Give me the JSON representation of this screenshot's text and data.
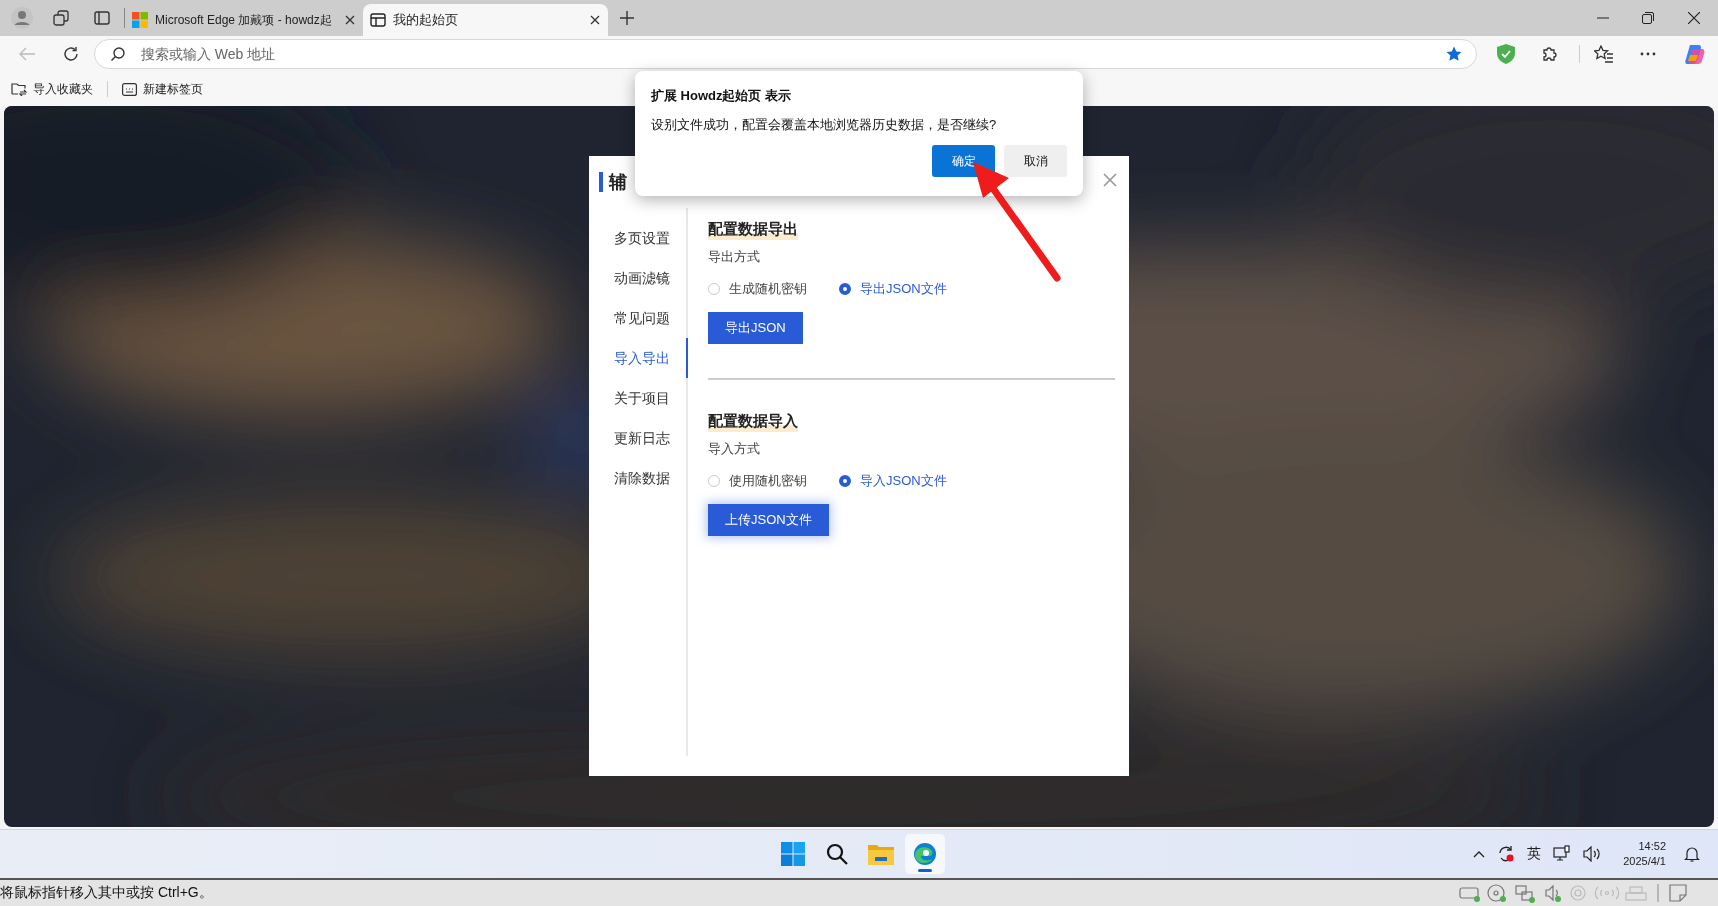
{
  "browser": {
    "tabs": [
      {
        "title": "Microsoft Edge 加戴项 - howdz起",
        "kind": "store",
        "selected": false
      },
      {
        "title": "我的起始页",
        "kind": "page",
        "selected": true
      }
    ],
    "address_placeholder": "搜索或输入 Web 地址",
    "favorite_starred": true,
    "favorites_bar": [
      {
        "label": "导入收藏夹",
        "kind": "import"
      },
      {
        "label": "新建标签页",
        "kind": "newtab"
      }
    ]
  },
  "settings": {
    "title": "辅",
    "nav": [
      {
        "label": "多页设置",
        "selected": false
      },
      {
        "label": "动画滤镜",
        "selected": false
      },
      {
        "label": "常见问题",
        "selected": false
      },
      {
        "label": "导入导出",
        "selected": true
      },
      {
        "label": "关于项目",
        "selected": false
      },
      {
        "label": "更新日志",
        "selected": false
      },
      {
        "label": "清除数据",
        "selected": false
      }
    ],
    "sections": [
      {
        "heading": "配置数据导出",
        "method_label": "导出方式",
        "options": [
          {
            "label": "生成随机密钥",
            "selected": false
          },
          {
            "label": "导出JSON文件",
            "selected": true
          }
        ],
        "button": {
          "label": "导出JSON",
          "focused": false
        }
      },
      {
        "heading": "配置数据导入",
        "method_label": "导入方式",
        "options": [
          {
            "label": "使用随机密钥",
            "selected": false
          },
          {
            "label": "导入JSON文件",
            "selected": true
          }
        ],
        "button": {
          "label": "上传JSON文件",
          "focused": true
        }
      }
    ]
  },
  "dialog": {
    "title": "扩展 Howdz起始页 表示",
    "message": "设别文件成功，配置会覆盖本地浏览器历史数据，是否继续?",
    "buttons": [
      {
        "label": "确定",
        "primary": true
      },
      {
        "label": "取消",
        "primary": false
      }
    ]
  },
  "taskbar": {
    "apps": [
      {
        "kind": "start",
        "active": false
      },
      {
        "kind": "search",
        "active": false
      },
      {
        "kind": "explorer",
        "active": false
      },
      {
        "kind": "edge",
        "active": true
      }
    ],
    "ime": "英",
    "time": "14:52",
    "date": "2025/4/1"
  },
  "vm_status": {
    "text": "将鼠标指针移入其中或按 Ctrl+G。"
  }
}
